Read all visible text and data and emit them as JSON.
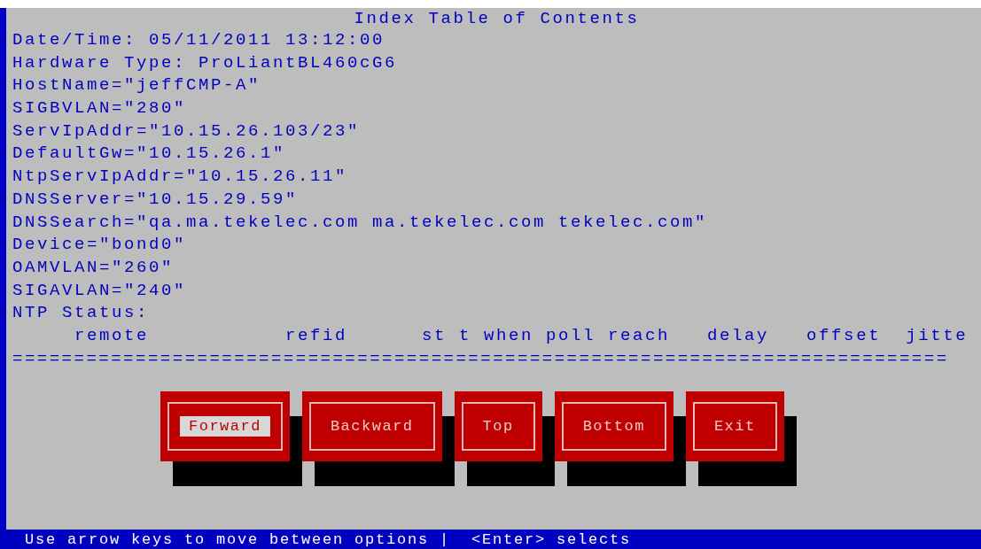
{
  "title": "Index Table of Contents",
  "lines": [
    "Date/Time: 05/11/2011 13:12:00",
    "Hardware Type: ProLiantBL460cG6",
    "HostName=\"jeffCMP-A\"",
    "SIGBVLAN=\"280\"",
    "ServIpAddr=\"10.15.26.103/23\"",
    "DefaultGw=\"10.15.26.1\"",
    "NtpServIpAddr=\"10.15.26.11\"",
    "DNSServer=\"10.15.29.59\"",
    "DNSSearch=\"qa.ma.tekelec.com ma.tekelec.com tekelec.com\"",
    "Device=\"bond0\"",
    "OAMVLAN=\"260\"",
    "SIGAVLAN=\"240\"",
    "NTP Status:"
  ],
  "ntp_header": "     remote           refid      st t when poll reach   delay   offset  jitte",
  "separator": "============================================================================",
  "buttons": [
    {
      "label": "Forward",
      "selected": true
    },
    {
      "label": "Backward",
      "selected": false
    },
    {
      "label": "Top",
      "selected": false
    },
    {
      "label": "Bottom",
      "selected": false
    },
    {
      "label": "Exit",
      "selected": false
    }
  ],
  "status_bar": "Use arrow keys to move between options |  <Enter> selects"
}
